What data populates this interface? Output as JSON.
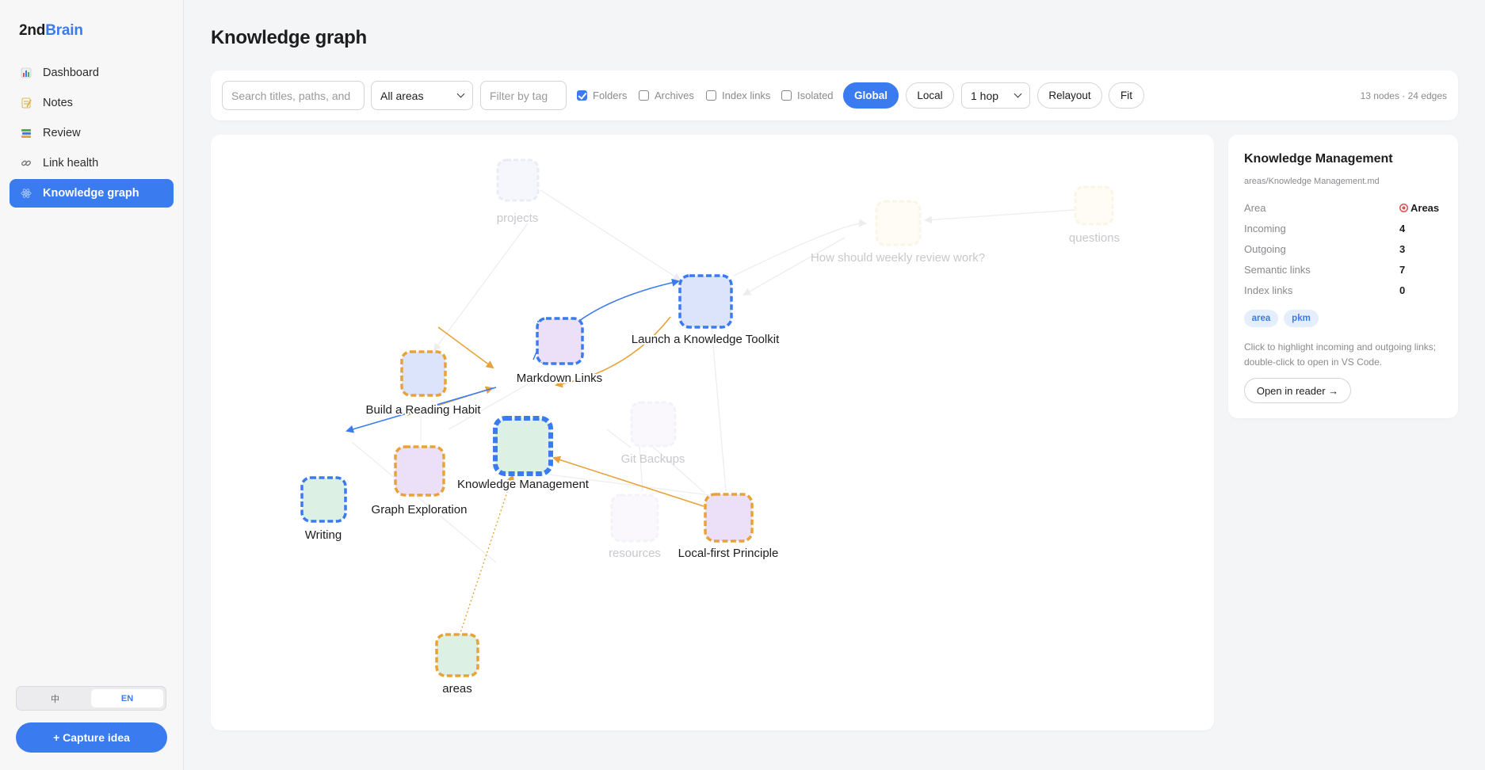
{
  "brand": {
    "part1": "2nd",
    "part2": "Brain"
  },
  "sidebar": {
    "items": [
      {
        "label": "Dashboard",
        "icon": "bar-chart-icon"
      },
      {
        "label": "Notes",
        "icon": "memo-icon"
      },
      {
        "label": "Review",
        "icon": "books-icon"
      },
      {
        "label": "Link health",
        "icon": "link-icon"
      },
      {
        "label": "Knowledge graph",
        "icon": "atom-icon",
        "active": true
      }
    ],
    "lang_zh": "中",
    "lang_en": "EN",
    "capture_label": "+ Capture idea"
  },
  "page": {
    "title": "Knowledge graph"
  },
  "toolbar": {
    "search_placeholder": "Search titles, paths, and",
    "area_select": "All areas",
    "tag_placeholder": "Filter by tag",
    "folders": "Folders",
    "archives": "Archives",
    "index_links": "Index links",
    "isolated": "Isolated",
    "global": "Global",
    "local": "Local",
    "hop": "1 hop",
    "relayout": "Relayout",
    "fit": "Fit",
    "stats": "13 nodes · 24 edges"
  },
  "graph": {
    "nodes": [
      {
        "id": "projects",
        "label": "projects",
        "dim": true
      },
      {
        "id": "hswr",
        "label": "How should weekly review work?",
        "dim": true
      },
      {
        "id": "questions",
        "label": "questions",
        "dim": true
      },
      {
        "id": "lakt",
        "label": "Launch a Knowledge Toolkit"
      },
      {
        "id": "ml",
        "label": "Markdown Links"
      },
      {
        "id": "brh",
        "label": "Build a Reading Habit"
      },
      {
        "id": "km",
        "label": "Knowledge Management"
      },
      {
        "id": "gb",
        "label": "Git Backups",
        "dim": true
      },
      {
        "id": "ge",
        "label": "Graph Exploration"
      },
      {
        "id": "writing",
        "label": "Writing"
      },
      {
        "id": "resources",
        "label": "resources",
        "dim": true
      },
      {
        "id": "lfp",
        "label": "Local-first Principle"
      },
      {
        "id": "areas",
        "label": "areas"
      }
    ]
  },
  "detail": {
    "title": "Knowledge Management",
    "path": "areas/Knowledge Management.md",
    "rows": [
      {
        "label": "Area",
        "value": "Areas",
        "icon": "dart-icon"
      },
      {
        "label": "Incoming",
        "value": "4"
      },
      {
        "label": "Outgoing",
        "value": "3"
      },
      {
        "label": "Semantic links",
        "value": "7"
      },
      {
        "label": "Index links",
        "value": "0"
      }
    ],
    "tags": [
      "area",
      "pkm"
    ],
    "hint": "Click to highlight incoming and outgoing links; double-click to open in VS Code.",
    "open_label": "Open in reader →"
  },
  "colors": {
    "accent": "#3a7bf0",
    "orange": "#e8a23a",
    "blue_fill": "#dbe4fa",
    "purple_fill": "#ece0f8",
    "green_fill": "#dcf1e3"
  }
}
